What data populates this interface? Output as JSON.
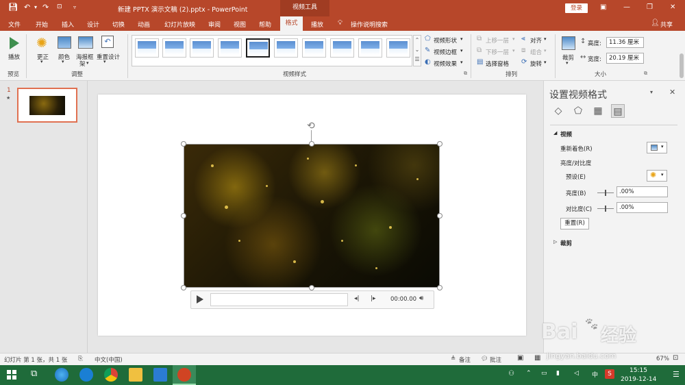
{
  "titlebar": {
    "doc_title": "新建 PPTX 演示文稿 (2).pptx  -  PowerPoint",
    "context_tools": "视频工具",
    "login": "登录"
  },
  "tabs": {
    "file": "文件",
    "home": "开始",
    "insert": "插入",
    "design": "设计",
    "transitions": "切换",
    "animations": "动画",
    "slideshow": "幻灯片放映",
    "review": "审阅",
    "view": "视图",
    "help": "帮助",
    "format": "格式",
    "playback": "播放",
    "tellme": "操作说明搜索",
    "share": "共享"
  },
  "ribbon": {
    "preview_group": "预览",
    "play": "播放",
    "adjust_group": "调整",
    "corrections": "更正",
    "color": "颜色",
    "poster_frame": "海报框",
    "poster_frame2": "架",
    "reset_design": "重置设计",
    "styles_group": "视频样式",
    "video_shape": "视频形状",
    "video_border": "视频边框",
    "video_effects": "视频效果",
    "arrange_group": "排列",
    "bring_forward": "上移一层",
    "send_backward": "下移一层",
    "selection_pane": "选择窗格",
    "align": "对齐",
    "group": "组合",
    "rotate": "旋转",
    "size_group": "大小",
    "crop": "裁剪",
    "height_label": "高度:",
    "height_value": "11.36 厘米",
    "width_label": "宽度:",
    "width_value": "20.19 厘米"
  },
  "slides": {
    "number": "1",
    "star": "★"
  },
  "player": {
    "time": "00:00.00"
  },
  "panel": {
    "title": "设置视频格式",
    "video_section": "视频",
    "recolor": "重新着色(R)",
    "brightness_contrast": "亮度/对比度",
    "preset": "预设(E)",
    "brightness": "亮度(B)",
    "brightness_value": ".00%",
    "contrast": "对比度(C)",
    "contrast_value": ".00%",
    "reset": "重置(R)",
    "crop_section": "裁剪"
  },
  "status": {
    "slide_info": "幻灯片 第 1 张，共 1 张",
    "language": "中文(中国)",
    "notes": "备注",
    "comments": "批注",
    "zoom": "67%"
  },
  "taskbar": {
    "ime": "中",
    "time": "15:15",
    "date": "2019-12-14"
  },
  "watermark": {
    "text1": "Bai",
    "text2": "经验",
    "url": "jingyan.baidu.com"
  },
  "colors": {
    "accent": "#b7472a",
    "taskbar": "#1f6b3a"
  }
}
